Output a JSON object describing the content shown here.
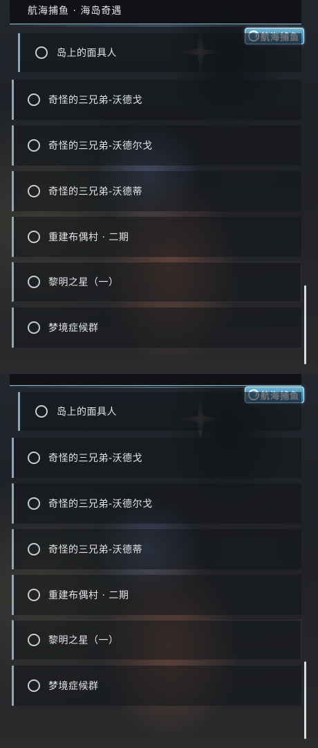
{
  "header": {
    "title": "航海捕鱼 · 海岛奇遇"
  },
  "badge": {
    "label": "航海捕鱼",
    "icon": "anchor-icon",
    "color": "#4a94c2"
  },
  "quests": [
    {
      "label": "岛上的面具人"
    },
    {
      "label": "奇怪的三兄弟-沃德戈"
    },
    {
      "label": "奇怪的三兄弟-沃德尔戈"
    },
    {
      "label": "奇怪的三兄弟-沃德蒂"
    },
    {
      "label": "重建布偶村 · 二期"
    },
    {
      "label": "黎明之星（一）"
    },
    {
      "label": "梦境症候群"
    }
  ],
  "colors": {
    "accent": "#8aa9b7",
    "text": "#e3e5e8",
    "header_line": "#7fb4c8"
  }
}
